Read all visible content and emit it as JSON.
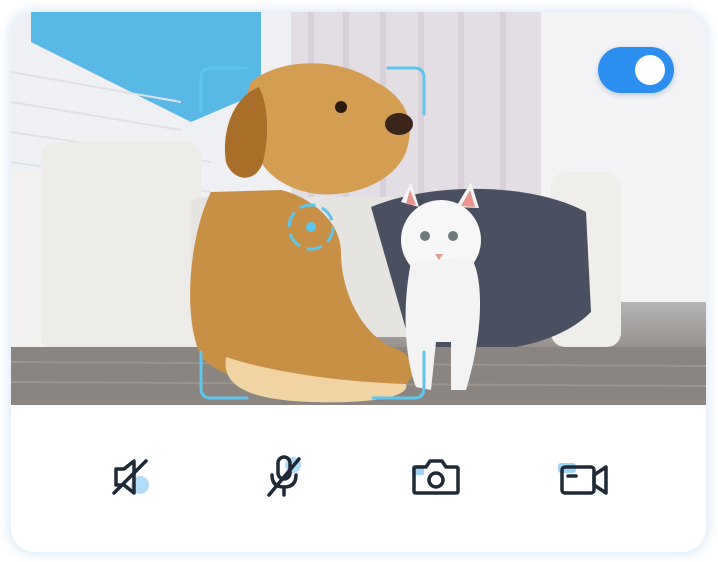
{
  "camera": {
    "tracking_enabled": true,
    "subjects": [
      "dog",
      "cat"
    ]
  },
  "controls": [
    {
      "name": "speaker-muted",
      "icon": "speaker-muted-icon"
    },
    {
      "name": "microphone-muted",
      "icon": "microphone-muted-icon"
    },
    {
      "name": "snapshot",
      "icon": "camera-icon"
    },
    {
      "name": "record-video",
      "icon": "video-camera-icon"
    }
  ],
  "colors": {
    "accent": "#2c8ff0",
    "focus_frame": "#5cc6ef",
    "icon_stroke": "#1f2a36",
    "icon_highlight": "#9fd4f6"
  }
}
